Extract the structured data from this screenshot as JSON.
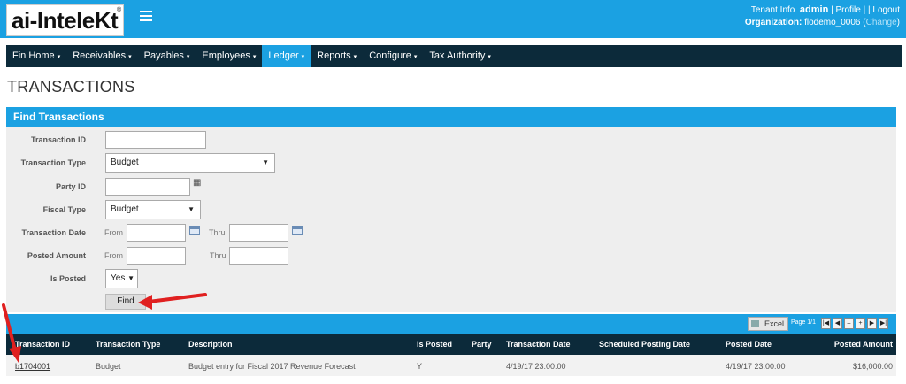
{
  "header": {
    "logo": "ai-InteleKt",
    "logo_reg": "®",
    "tenant_info": "Tenant Info",
    "user": "admin",
    "profile": "Profile",
    "logout": "Logout",
    "sep1": "|",
    "sep2": "| |",
    "org_label": "Organization:",
    "org_value": "flodemo_0006",
    "change": "Change",
    "paren_open": "(",
    "paren_close": ")"
  },
  "nav": {
    "items": [
      {
        "label": "Fin Home"
      },
      {
        "label": "Receivables"
      },
      {
        "label": "Payables"
      },
      {
        "label": "Employees"
      },
      {
        "label": "Ledger"
      },
      {
        "label": "Reports"
      },
      {
        "label": "Configure"
      },
      {
        "label": "Tax Authority"
      }
    ],
    "active": "Ledger",
    "caret": "▾"
  },
  "page_title": "TRANSACTIONS",
  "find": {
    "title": "Find  Transactions",
    "fields": {
      "transaction_id": {
        "label": "Transaction ID",
        "value": ""
      },
      "transaction_type": {
        "label": "Transaction Type",
        "value": "Budget"
      },
      "party_id": {
        "label": "Party ID",
        "value": ""
      },
      "fiscal_type": {
        "label": "Fiscal Type",
        "value": "Budget"
      },
      "transaction_date": {
        "label": "Transaction Date",
        "from": "From",
        "thru": "Thru"
      },
      "posted_amount": {
        "label": "Posted Amount",
        "from": "From",
        "thru": "Thru"
      },
      "is_posted": {
        "label": "Is Posted",
        "value": "Yes"
      }
    },
    "find_button": "Find",
    "dropdown_arrow": "▼"
  },
  "results": {
    "excel": "Excel",
    "page_info": "Page 1/1",
    "pager": [
      "|◀",
      "◀",
      "–",
      "+",
      "▶",
      "▶|"
    ],
    "columns": [
      "Transaction ID",
      "Transaction Type",
      "Description",
      "Is Posted",
      "Party",
      "Transaction Date",
      "Scheduled Posting Date",
      "Posted Date",
      "Posted Amount"
    ],
    "rows": [
      {
        "transaction_id": "b1704001",
        "transaction_type": "Budget",
        "description": "Budget entry for Fiscal 2017 Revenue Forecast",
        "is_posted": "Y",
        "party": "",
        "transaction_date": "4/19/17 23:00:00",
        "scheduled_posting_date": "",
        "posted_date": "4/19/17 23:00:00",
        "posted_amount": "$16,000.00"
      }
    ]
  },
  "colors": {
    "accent": "#1ba1e2",
    "navbar": "#0c2a3a",
    "annotation_arrow": "#e02020"
  }
}
